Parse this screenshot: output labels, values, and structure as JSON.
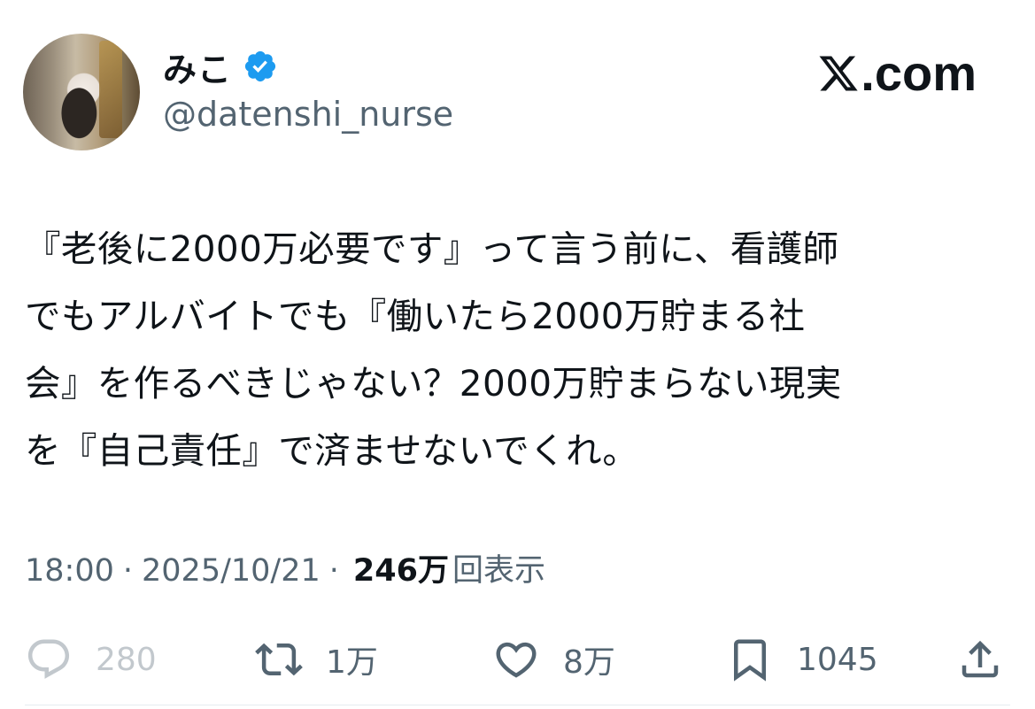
{
  "author": {
    "display_name": "みこ",
    "handle": "@datenshi_nurse",
    "verified_icon": "verified-badge-icon"
  },
  "brand": {
    "label": ".com",
    "icon": "x-logo-icon"
  },
  "tweet": {
    "text": "『老後に2000万必要です』って言う前に、看護師\nでもアルバイトでも『働いたら2000万貯まる社\n会』を作るべきじゃない？2000万貯まらない現実\nを『自己責任』で済ませないでくれ。"
  },
  "meta": {
    "time": "18:00",
    "sep1": "·",
    "date": "2025/10/21",
    "sep2": "·",
    "views": "246万",
    "views_label": "回表示"
  },
  "actions": {
    "reply": {
      "icon": "reply-icon",
      "count": "280"
    },
    "retweet": {
      "icon": "retweet-icon",
      "count": "1万"
    },
    "like": {
      "icon": "heart-icon",
      "count": "8万"
    },
    "bookmark": {
      "icon": "bookmark-icon",
      "count": "1045"
    },
    "share": {
      "icon": "share-icon"
    }
  },
  "colors": {
    "text": "#0f1419",
    "secondary": "#536471",
    "verified": "#1d9bf0",
    "background": "#ffffff"
  }
}
